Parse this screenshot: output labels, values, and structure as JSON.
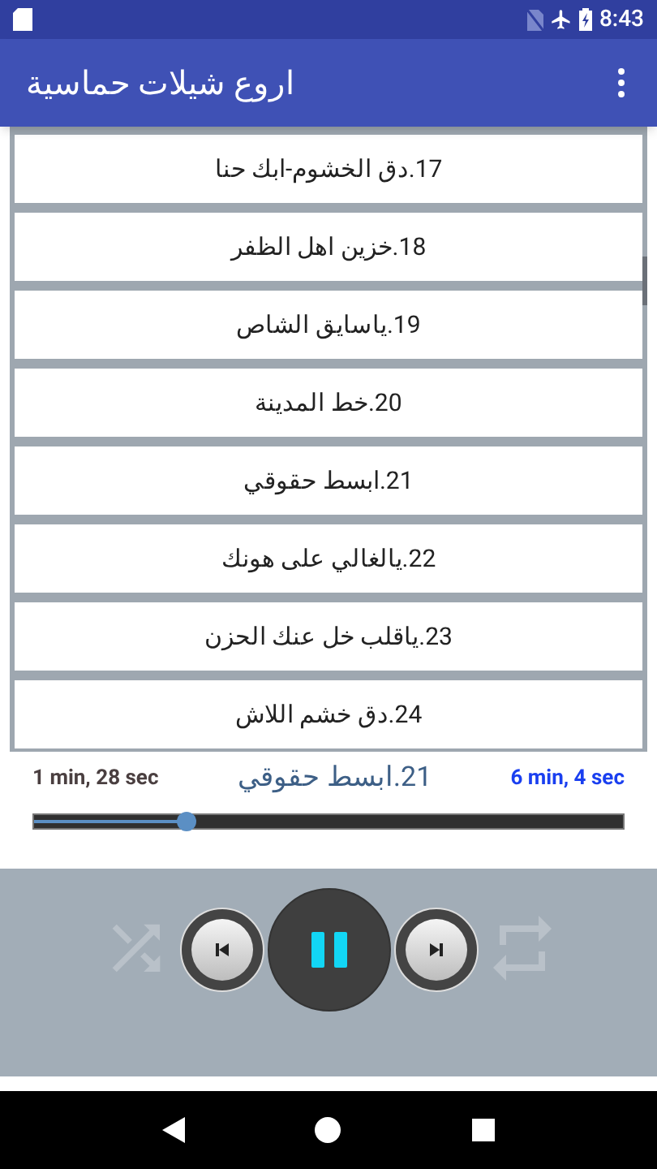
{
  "status_bar": {
    "time": "8:43"
  },
  "app_bar": {
    "title": "اروع شيلات حماسية"
  },
  "tracks": [
    {
      "title": "17.دق الخشوم-ابك حنا",
      "selected": false
    },
    {
      "title": "18.خزين اهل الظفر",
      "selected": false
    },
    {
      "title": "19.ياسايق الشاص",
      "selected": false
    },
    {
      "title": "20.خط المدينة",
      "selected": false
    },
    {
      "title": "21.ابسط حقوقي",
      "selected": false
    },
    {
      "title": "22.يالغالي على هونك",
      "selected": false
    },
    {
      "title": "23.ياقلب خل عنك الحزن",
      "selected": false
    },
    {
      "title": "24.دق خشم اللاش",
      "selected": false
    }
  ],
  "player": {
    "elapsed": "1 min, 28 sec",
    "now_playing": "21.ابسط حقوقي",
    "duration": "6 min, 4 sec",
    "level": 0.26,
    "playing": true,
    "shuffle_on": false,
    "repeat_on": false
  }
}
